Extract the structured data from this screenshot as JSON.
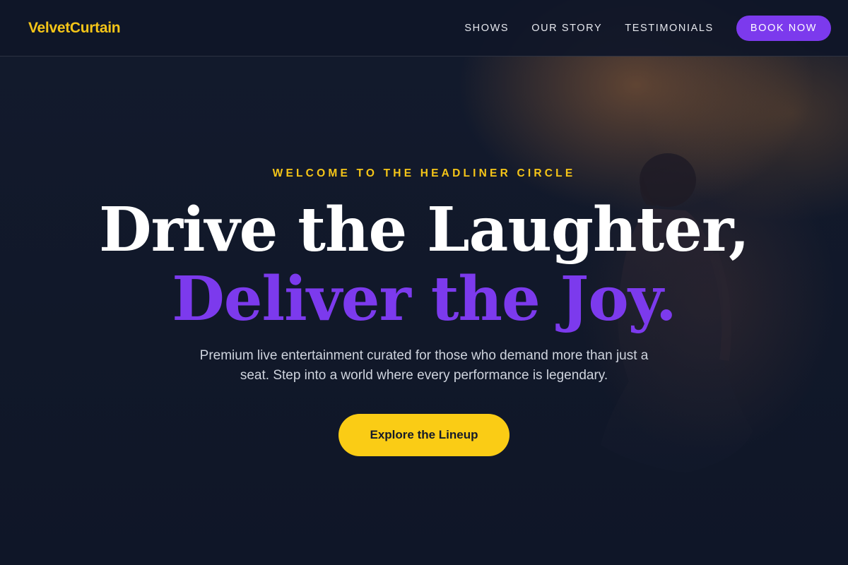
{
  "nav": {
    "brand": "VelvetCurtain",
    "links": [
      {
        "label": "SHOWS"
      },
      {
        "label": "OUR STORY"
      },
      {
        "label": "TESTIMONIALS"
      }
    ],
    "cta_label": "BOOK NOW"
  },
  "hero": {
    "eyebrow": "WELCOME TO THE HEADLINER CIRCLE",
    "headline_line1": "Drive the Laughter,",
    "headline_line2": "Deliver the Joy.",
    "subtitle": "Premium live entertainment curated for those who demand more than just a seat. Step into a world where every performance is legendary.",
    "cta_label": "Explore the Lineup"
  },
  "colors": {
    "background": "#0f1628",
    "brand_gold": "#f5c518",
    "accent_purple": "#7c3aed",
    "cta_yellow": "#facc15"
  }
}
